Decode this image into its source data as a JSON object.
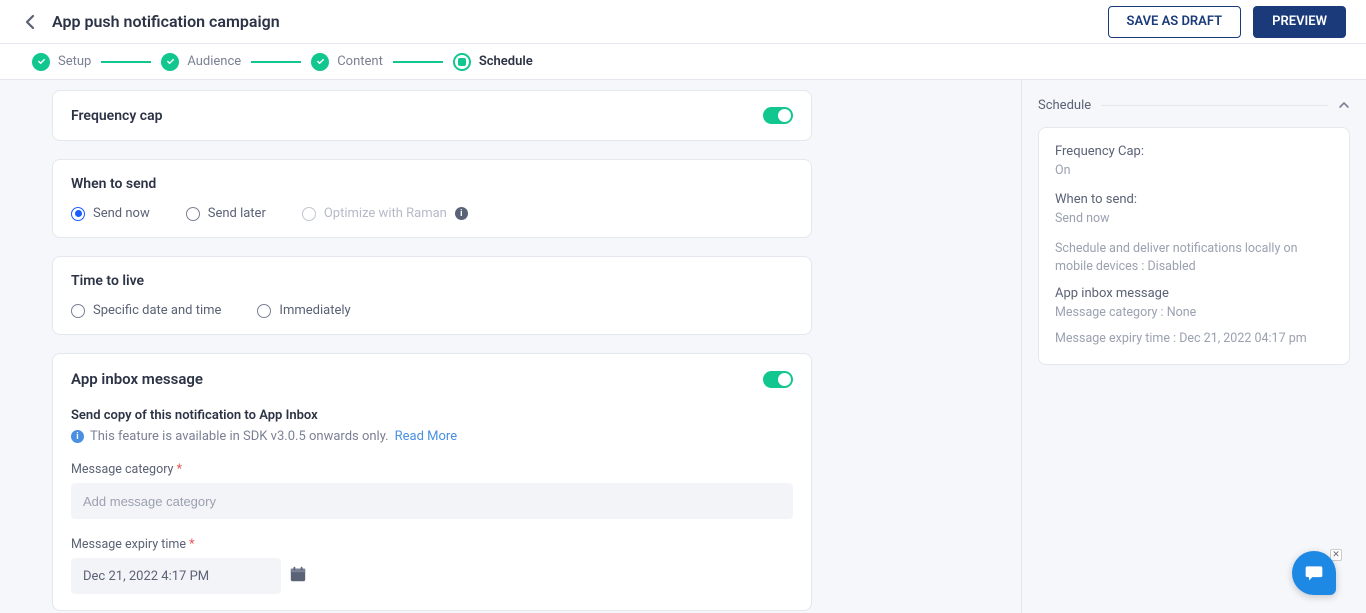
{
  "header": {
    "title": "App push notification campaign",
    "save_draft": "SAVE AS DRAFT",
    "preview": "PREVIEW"
  },
  "stepper": {
    "steps": [
      {
        "label": "Setup"
      },
      {
        "label": "Audience"
      },
      {
        "label": "Content"
      },
      {
        "label": "Schedule"
      }
    ]
  },
  "cards": {
    "frequency_cap": {
      "title": "Frequency cap"
    },
    "when_to_send": {
      "title": "When to send",
      "options": {
        "send_now": "Send now",
        "send_later": "Send later",
        "optimize": "Optimize with Raman"
      }
    },
    "time_to_live": {
      "title": "Time to live",
      "options": {
        "specific": "Specific date and time",
        "immediately": "Immediately"
      }
    },
    "app_inbox": {
      "title": "App inbox message",
      "sub": "Send copy of this notification to App Inbox",
      "info": "This feature is available in SDK v3.0.5 onwards only.",
      "read_more": "Read More",
      "msg_cat_label": "Message category",
      "msg_cat_placeholder": "Add message category",
      "msg_expiry_label": "Message expiry time",
      "msg_expiry_value": "Dec 21, 2022 4:17 PM"
    }
  },
  "summary": {
    "heading": "Schedule",
    "freq_label": "Frequency Cap:",
    "freq_value": "On",
    "when_label": "When to send:",
    "when_value": "Send now",
    "local_deliver": "Schedule and deliver notifications locally on mobile devices : Disabled",
    "inbox_label": "App inbox message",
    "inbox_cat": "Message category : None",
    "inbox_expiry": "Message expiry time : Dec 21, 2022 04:17 pm"
  }
}
